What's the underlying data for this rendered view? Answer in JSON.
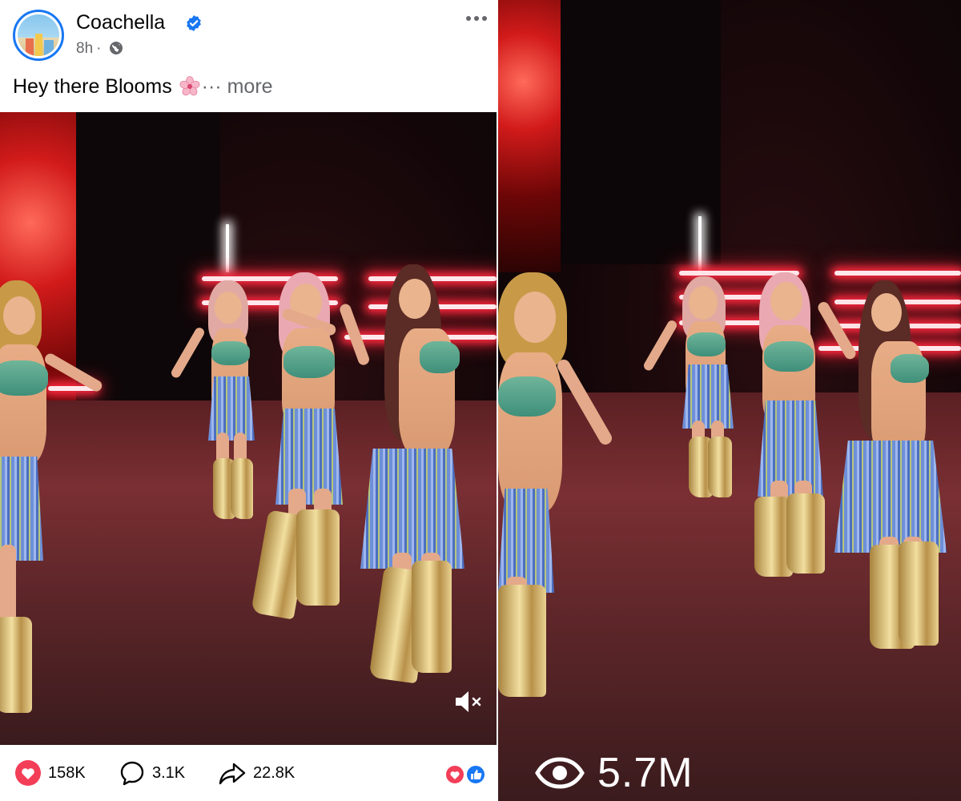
{
  "post": {
    "page_name": "Coachella",
    "time": "8h",
    "caption": "Hey there Blooms",
    "more_label": "more",
    "caption_ellipsis": "···"
  },
  "stats": {
    "likes": "158K",
    "comments": "3.1K",
    "shares": "22.8K"
  },
  "video": {
    "views": "5.7M",
    "muted": true
  },
  "colors": {
    "facebook_blue": "#1877f2",
    "like_red": "#f33e58",
    "text_secondary": "#65676b"
  },
  "icons": [
    "verified-badge-icon",
    "globe-icon",
    "more-options-icon",
    "cherry-blossom-icon",
    "heart-icon",
    "comment-icon",
    "share-icon",
    "mute-icon",
    "eye-icon"
  ]
}
